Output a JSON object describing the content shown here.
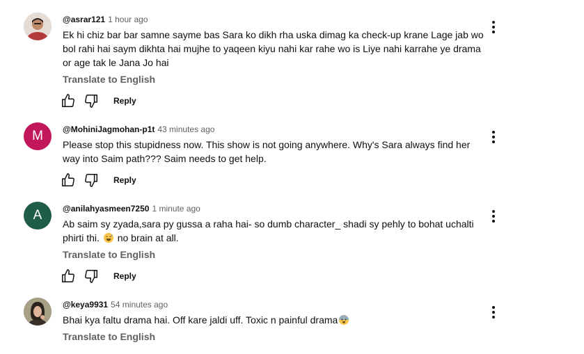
{
  "comments": [
    {
      "handle": "@asrar121",
      "time": "1 hour ago",
      "avatar_letter": "",
      "avatar_color": "#c9a894",
      "text": "Ek hi chiz bar bar samne sayme  bas Sara ko dikh rha uska dimag ka check-up krane Lage jab wo bol rahi hai saym dikhta hai mujhe to yaqeen kiyu nahi kar rahe wo is Liye nahi karrahe ye drama or age tak le Jana Jo hai",
      "translate": "Translate to English",
      "reply": "Reply"
    },
    {
      "handle": "@MohiniJagmohan-p1t",
      "time": "43 minutes ago",
      "avatar_letter": "M",
      "avatar_color": "#c2185b",
      "text": "Please stop this stupidness now. This show is not going anywhere. Why's Sara always find her way into Saim path??? Saim needs to get help.",
      "reply": "Reply"
    },
    {
      "handle": "@anilahyasmeen7250",
      "time": "1 minute ago",
      "avatar_letter": "A",
      "avatar_color": "#1f5c49",
      "text_before_emoji": "Ab saim sy zyada,sara py gussa a raha hai- so dumb character_ shadi sy pehly to bohat uchalti phirti thi. ",
      "text_after_emoji": " no brain at all.",
      "emoji": "grinning-sweat-face",
      "translate": "Translate to English",
      "reply": "Reply"
    },
    {
      "handle": "@keya9931",
      "time": "54 minutes ago",
      "avatar_letter": "",
      "avatar_color": "#7a6a55",
      "text": "Bhai kya faltu drama hai. Off kare jaldi uff. Toxic n painful drama",
      "emoji": "anxious-face-with-sweat",
      "translate": "Translate to English"
    }
  ]
}
